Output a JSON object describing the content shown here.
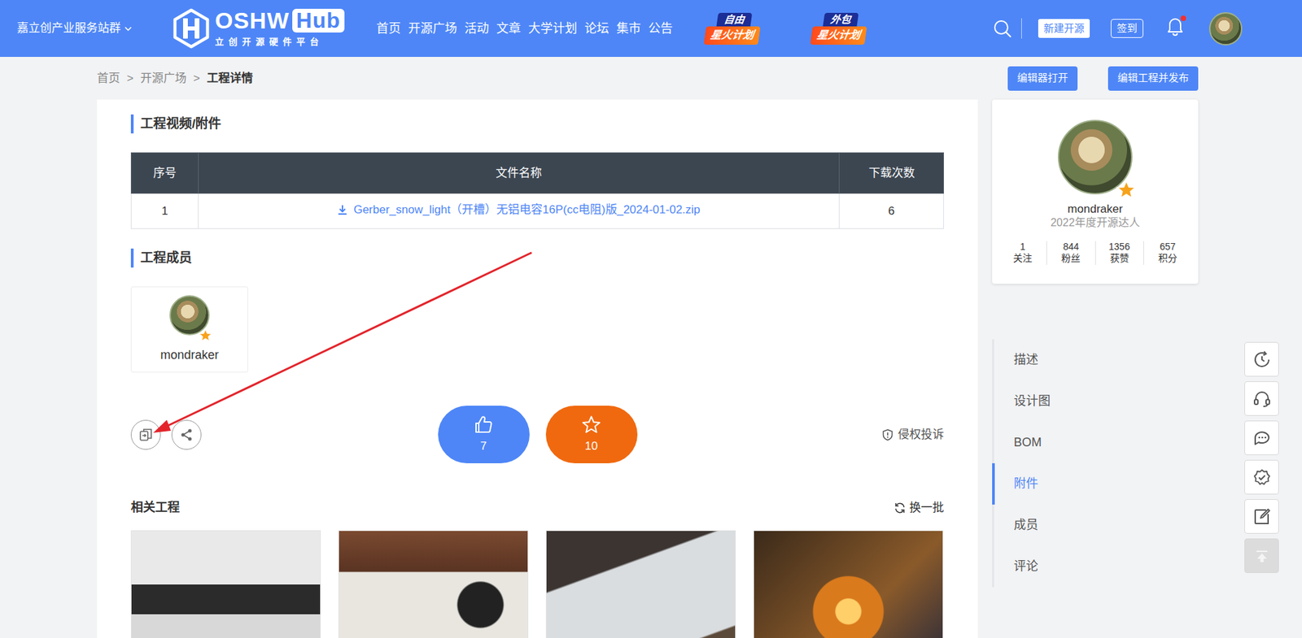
{
  "topbar": {
    "site_switcher": "嘉立创产业服务站群",
    "logo": {
      "name": "OSHW",
      "badge": "Hub",
      "subtitle": "立创开源硬件平台"
    },
    "nav": [
      "首页",
      "开源广场",
      "活动",
      "文章",
      "大学计划",
      "论坛",
      "集市",
      "公告"
    ],
    "promos": [
      {
        "tag": "自由",
        "label": "星火计划"
      },
      {
        "tag": "外包",
        "label": "星火计划"
      }
    ],
    "new_project": "新建开源",
    "checkin": "签到",
    "notifications_unread": true
  },
  "breadcrumb": {
    "items": [
      {
        "label": "首页",
        "current": false
      },
      {
        "label": "开源广场",
        "current": false
      },
      {
        "label": "工程详情",
        "current": true
      }
    ],
    "separator": ">"
  },
  "header_buttons": [
    "编辑器打开",
    "编辑工程并发布"
  ],
  "attachments": {
    "title": "工程视频/附件",
    "columns": [
      "序号",
      "文件名称",
      "下载次数"
    ],
    "rows": [
      [
        "1",
        "Gerber_snow_light（开槽）无铝电容16P(cc电阻)版_2024-01-02.zip",
        "6"
      ]
    ]
  },
  "members": {
    "title": "工程成员",
    "items": [
      {
        "name": "mondraker"
      }
    ]
  },
  "reactions": {
    "likes": "7",
    "favorites": "10",
    "report": "侵权投诉"
  },
  "related": {
    "title": "相关工程",
    "refresh": "换一批",
    "items": [
      {
        "kind": "photo"
      },
      {
        "kind": "photo"
      },
      {
        "kind": "photo"
      },
      {
        "kind": "photo"
      }
    ]
  },
  "author": {
    "name": "mondraker",
    "title": "2022年度开源达人",
    "stats": [
      {
        "value": "1",
        "label": "关注"
      },
      {
        "value": "844",
        "label": "粉丝"
      },
      {
        "value": "1356",
        "label": "获赞"
      },
      {
        "value": "657",
        "label": "积分"
      }
    ]
  },
  "toc": [
    {
      "label": "描述",
      "selected": false
    },
    {
      "label": "设计图",
      "selected": false
    },
    {
      "label": "BOM",
      "selected": false
    },
    {
      "label": "附件",
      "selected": true
    },
    {
      "label": "成员",
      "selected": false
    },
    {
      "label": "评论",
      "selected": false
    }
  ],
  "tools": [
    {
      "disabled": false
    },
    {
      "disabled": false
    },
    {
      "disabled": false
    },
    {
      "disabled": false
    },
    {
      "disabled": false
    },
    {
      "disabled": true
    }
  ]
}
